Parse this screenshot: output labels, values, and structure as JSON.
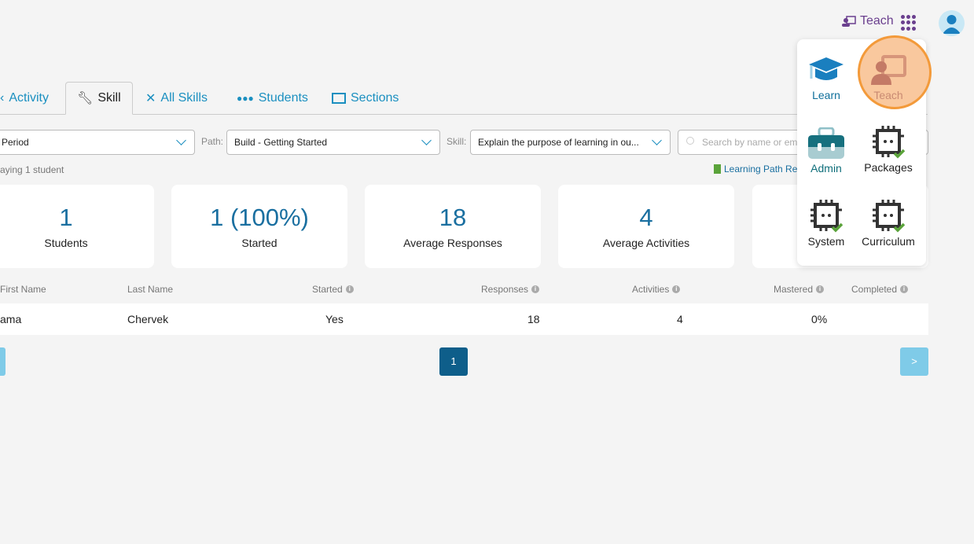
{
  "header": {
    "role_label": "Teach"
  },
  "tabs": [
    {
      "label": "Activity"
    },
    {
      "label": "Skill"
    },
    {
      "label": "All Skills"
    },
    {
      "label": "Students"
    },
    {
      "label": "Sections"
    }
  ],
  "filters": {
    "period_value": "Period",
    "path_label": "Path:",
    "path_value": "Build - Getting Started",
    "skill_label": "Skill:",
    "skill_value": "Explain the purpose of learning in ou...",
    "search_placeholder": "Search by name or email"
  },
  "status_text": "aying 1 student",
  "report_link": "Learning Path Re",
  "cards": [
    {
      "value": "1",
      "label": "Students"
    },
    {
      "value": "1 (100%)",
      "label": "Started"
    },
    {
      "value": "18",
      "label": "Average Responses"
    },
    {
      "value": "4",
      "label": "Average Activities"
    }
  ],
  "table": {
    "headers": [
      "First Name",
      "Last Name",
      "Started",
      "Responses",
      "Activities",
      "Mastered",
      "Completed"
    ],
    "rows": [
      [
        "ama",
        "Chervek",
        "Yes",
        "18",
        "4",
        "0%",
        ""
      ]
    ]
  },
  "pagination": {
    "page": "1",
    "next": ">"
  },
  "apps": [
    {
      "label": "Learn"
    },
    {
      "label": "Teach"
    },
    {
      "label": "Admin"
    },
    {
      "label": "Packages"
    },
    {
      "label": "System"
    },
    {
      "label": "Curriculum"
    }
  ],
  "colors": {
    "accent": "#1a8fc0",
    "highlight": "#f39a3a",
    "purple": "#6a3f8e"
  }
}
